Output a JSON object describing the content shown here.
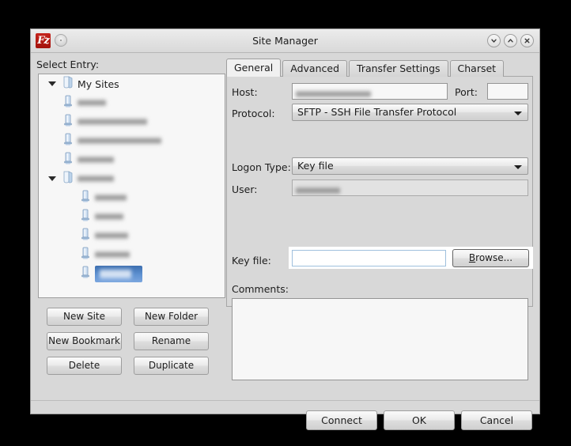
{
  "window": {
    "title": "Site Manager",
    "logo_text": "Fz",
    "buttons": {
      "minimize": "minimize-icon",
      "maximize": "maximize-icon",
      "close": "close-icon"
    }
  },
  "left": {
    "select_label": "Select Entry:",
    "tree": {
      "root": {
        "label": "My Sites",
        "expanded": true,
        "icon": "folder-icon"
      },
      "children": [
        {
          "label": "",
          "redacted": true,
          "redacted_width": 36,
          "icon": "server-icon",
          "depth": 2,
          "selected": false
        },
        {
          "label": "",
          "redacted": true,
          "redacted_width": 88,
          "icon": "server-icon",
          "depth": 2,
          "selected": false
        },
        {
          "label": "",
          "redacted": true,
          "redacted_width": 106,
          "icon": "server-icon",
          "depth": 2,
          "selected": false
        },
        {
          "label": "",
          "redacted": true,
          "redacted_width": 46,
          "icon": "server-icon",
          "depth": 2,
          "selected": false
        },
        {
          "label": "",
          "redacted": true,
          "redacted_width": 46,
          "icon": "folder-icon",
          "depth": 2,
          "selected": false,
          "expanded": true
        },
        {
          "label": "",
          "redacted": true,
          "redacted_width": 40,
          "icon": "server-icon",
          "depth": 3,
          "selected": false
        },
        {
          "label": "",
          "redacted": true,
          "redacted_width": 36,
          "icon": "server-icon",
          "depth": 3,
          "selected": false
        },
        {
          "label": "",
          "redacted": true,
          "redacted_width": 42,
          "icon": "server-icon",
          "depth": 3,
          "selected": false
        },
        {
          "label": "",
          "redacted": true,
          "redacted_width": 44,
          "icon": "server-icon",
          "depth": 3,
          "selected": false
        },
        {
          "label": "",
          "redacted": true,
          "redacted_width": 40,
          "icon": "server-icon",
          "depth": 3,
          "selected": true
        }
      ]
    },
    "buttons": [
      {
        "label": "New Site",
        "name": "new-site-button"
      },
      {
        "label": "New Folder",
        "name": "new-folder-button"
      },
      {
        "label": "New Bookmark",
        "name": "new-bookmark-button"
      },
      {
        "label": "Rename",
        "name": "rename-button"
      },
      {
        "label": "Delete",
        "name": "delete-button"
      },
      {
        "label": "Duplicate",
        "name": "duplicate-button"
      }
    ]
  },
  "tabs": [
    {
      "label": "General",
      "active": true
    },
    {
      "label": "Advanced",
      "active": false
    },
    {
      "label": "Transfer Settings",
      "active": false
    },
    {
      "label": "Charset",
      "active": false
    }
  ],
  "general": {
    "host_label": "Host:",
    "host_value": "",
    "host_redacted": true,
    "port_label": "Port:",
    "port_value": "",
    "protocol_label": "Protocol:",
    "protocol_value": "SFTP - SSH File Transfer Protocol",
    "logon_type_label": "Logon Type:",
    "logon_type_value": "Key file",
    "user_label": "User:",
    "user_value": "",
    "user_redacted": true,
    "user_disabled": true,
    "keyfile_label": "Key file:",
    "keyfile_value": "",
    "browse_label": "Browse...",
    "browse_accel": "B",
    "comments_label": "Comments:",
    "comments_value": ""
  },
  "footer": {
    "connect_label": "Connect",
    "ok_label": "OK",
    "cancel_label": "Cancel"
  },
  "colors": {
    "window_bg": "#d8d8d8",
    "selection_blue": "#3d6fb0",
    "logo_red": "#c5241c",
    "field_bg": "#f7f7f7"
  }
}
